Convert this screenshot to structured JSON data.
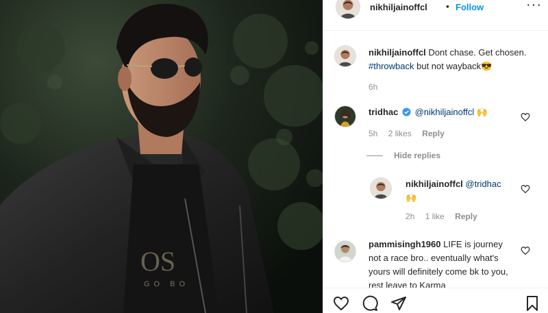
{
  "header": {
    "username": "nikhiljainoffcl",
    "dot": "•",
    "follow": "Follow",
    "more": "···"
  },
  "caption": {
    "username": "nikhiljainoffcl",
    "text_before": "Dont chase. Get chosen.",
    "hashtag": "#throwback",
    "text_after": "but not wayback😎",
    "time": "6h"
  },
  "comments": [
    {
      "username": "tridhac",
      "verified": true,
      "mention": "@nikhiljainoffcl",
      "text": "🙌",
      "time": "5h",
      "likes": "2 likes",
      "reply": "Reply"
    }
  ],
  "hide_replies": "Hide replies",
  "reply_comment": {
    "username": "nikhiljainoffcl",
    "mention": "@tridhac",
    "text": "🙌",
    "time": "2h",
    "likes": "1 like",
    "reply": "Reply"
  },
  "comment2": {
    "username": "pammisingh1960",
    "text": "LIFE is journey not a race bro.. eventually what's yours will definitely come bk to you, rest leave to Karma"
  },
  "icons": {
    "like": "heart-icon",
    "comment": "comment-icon",
    "share": "share-icon",
    "save": "bookmark-icon"
  }
}
